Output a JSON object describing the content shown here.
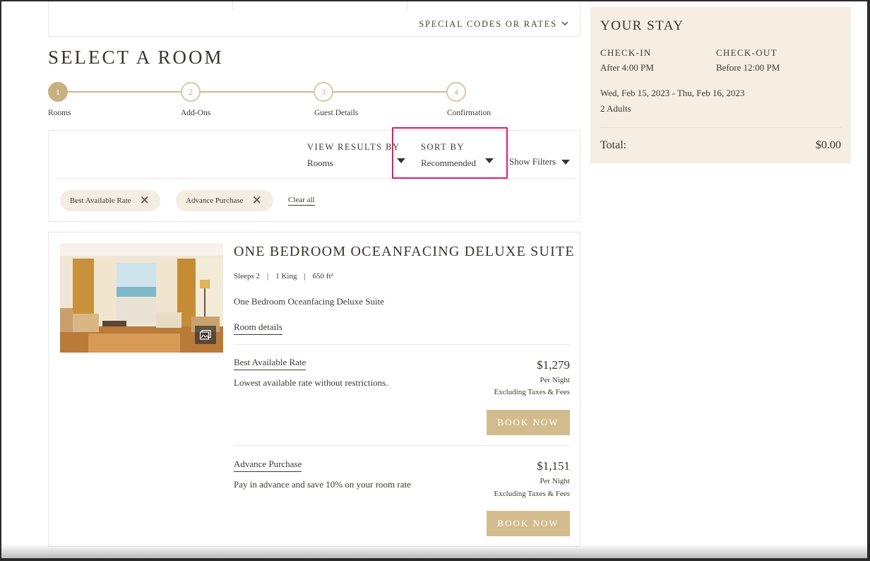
{
  "search": {
    "special_codes_label": "SPECIAL CODES OR RATES"
  },
  "page": {
    "title": "SELECT A ROOM"
  },
  "stepper": {
    "steps": [
      {
        "number": "1",
        "label": "Rooms",
        "active": true
      },
      {
        "number": "2",
        "label": "Add-Ons",
        "active": false
      },
      {
        "number": "3",
        "label": "Guest Details",
        "active": false
      },
      {
        "number": "4",
        "label": "Confirmation",
        "active": false
      }
    ]
  },
  "filters": {
    "view_results_label": "VIEW RESULTS BY",
    "view_results_value": "Rooms",
    "sort_by_label": "SORT BY",
    "sort_by_value": "Recommended",
    "show_filters_label": "Show Filters",
    "chips": [
      {
        "label": "Best Available Rate"
      },
      {
        "label": "Advance Purchase"
      }
    ],
    "clear_all_label": "Clear all",
    "highlight_color": "#e6196e"
  },
  "room": {
    "title": "ONE BEDROOM OCEANFACING DELUXE SUITE",
    "sleeps": "Sleeps 2",
    "bed": "1 King",
    "size": "650 ft²",
    "description": "One Bedroom Oceanfacing Deluxe Suite",
    "details_label": "Room details",
    "gallery_icon": "gallery-icon",
    "rates": [
      {
        "name": "Best Available Rate",
        "description": "Lowest available rate without restrictions.",
        "price": "$1,279",
        "per": "Per Night",
        "excluding": "Excluding Taxes & Fees",
        "button": "BOOK NOW"
      },
      {
        "name": "Advance Purchase",
        "description": "Pay in advance and save 10% on your room rate",
        "price": "$1,151",
        "per": "Per Night",
        "excluding": "Excluding Taxes & Fees",
        "button": "BOOK NOW"
      }
    ]
  },
  "stay": {
    "title": "YOUR STAY",
    "checkin_label": "CHECK-IN",
    "checkin_value": "After 4:00 PM",
    "checkout_label": "CHECK-OUT",
    "checkout_value": "Before 12:00 PM",
    "dates": "Wed, Feb 15, 2023 - Thu, Feb 16, 2023",
    "guests": "2 Adults",
    "total_label": "Total:",
    "total_value": "$0.00"
  },
  "colors": {
    "accent_gold": "#d2bc8e",
    "panel_bg": "#f6ede3",
    "chip_bg": "#f4ede4"
  }
}
